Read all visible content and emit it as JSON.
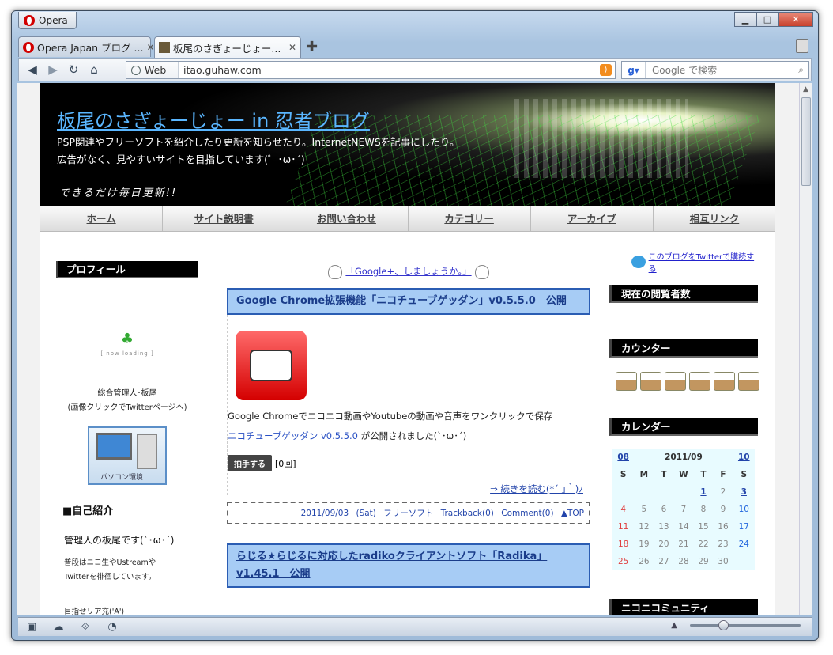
{
  "window": {
    "app_name": "Opera"
  },
  "tabs": [
    {
      "label": "Opera Japan ブログ ..."
    },
    {
      "label": "板尾のさぎょーじょー..."
    }
  ],
  "toolbar": {
    "web_label": "Web",
    "url": "itao.guhaw.com",
    "search_placeholder": "Google で検索"
  },
  "banner": {
    "title": "板尾のさぎょーじょー in 忍者ブログ",
    "sub1": "PSP関連やフリーソフトを紹介したり更新を知らせたり。InternetNEWSを記事にしたり。",
    "sub2": "広告がなく、見やすいサイトを目指しています(゜･ω･´)",
    "tagline": "できるだけ毎日更新!!"
  },
  "nav": [
    "ホーム",
    "サイト説明書",
    "お問い合わせ",
    "カテゴリー",
    "アーカイブ",
    "相互リンク"
  ],
  "left": {
    "profile_heading": "プロフィール",
    "loading": "[ now loading ]",
    "admin_line1": "総合管理人･板尾",
    "admin_line2": "(画像クリックでTwitterページへ)",
    "pc_label": "パソコン環境",
    "intro_heading": "■自己紹介",
    "intro": "管理人の板尾です(`･ω･´)",
    "intro_sub1": "普段はニコ生やUstreamや",
    "intro_sub2": "Twitterを徘徊しています。",
    "aim": "目指せリア充('A')"
  },
  "center": {
    "gplus": "「Google+、しましょうか。」",
    "post1": {
      "title": "Google Chrome拡張機能「ニコチューブゲッダン」v0.5.5.0　公開",
      "line1": "Google Chromeでニコニコ動画やYoutubeの動画や音声をワンクリックで保存",
      "link": "ニコチューブゲッダン v0.5.5.0",
      "line2_rest": " が公開されました(`･ω･´)",
      "clap": "拍手する",
      "clap_count": "[0回]",
      "more": "⇒ 続きを読む(*´ ｣｀)ﾉ",
      "date": "2011/09/03 (Sat)",
      "category": "フリーソフト",
      "trackback": "Trackback(0)",
      "comment": "Comment(0)",
      "top": "▲TOP"
    },
    "post2": {
      "title": "らじる★らじるに対応したradikoクライアントソフト「Radika」v1.45.1　公開"
    }
  },
  "right": {
    "twitter": "このブログをTwitterで購読する",
    "viewers": "現在の閲覧者数",
    "counter": "カウンター",
    "calendar": "カレンダー",
    "nico": "ニコニコミュニティ",
    "cal_prev": "08",
    "cal_month": "2011/09",
    "cal_next": "10",
    "cal_days": [
      "S",
      "M",
      "T",
      "W",
      "T",
      "F",
      "S"
    ],
    "cal_rows": [
      [
        "",
        "",
        "",
        "",
        "1",
        "2",
        "3"
      ],
      [
        "4",
        "5",
        "6",
        "7",
        "8",
        "9",
        "10"
      ],
      [
        "11",
        "12",
        "13",
        "14",
        "15",
        "16",
        "17"
      ],
      [
        "18",
        "19",
        "20",
        "21",
        "22",
        "23",
        "24"
      ],
      [
        "25",
        "26",
        "27",
        "28",
        "29",
        "30",
        ""
      ]
    ]
  }
}
